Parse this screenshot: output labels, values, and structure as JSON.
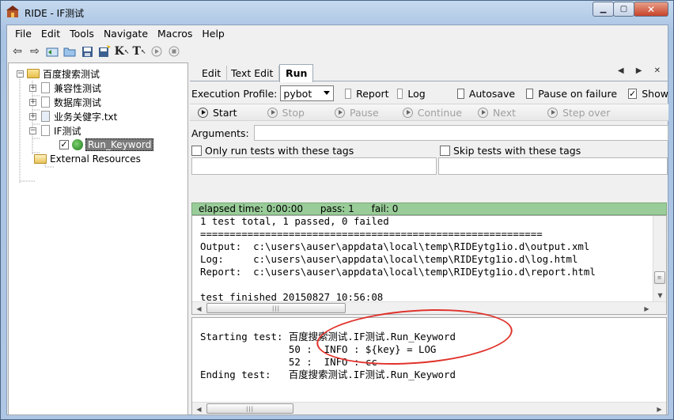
{
  "window": {
    "title": "RIDE - IF测试",
    "icons": [
      "ride-app-icon",
      "minimize-icon",
      "maximize-icon",
      "close-icon"
    ]
  },
  "menu": [
    "File",
    "Edit",
    "Tools",
    "Navigate",
    "Macros",
    "Help"
  ],
  "toolbar_icons": [
    "back-arrow-icon",
    "forward-arrow-icon",
    "open-suite-icon",
    "open-folder-icon",
    "save-icon",
    "save-all-icon",
    "search-keyword-icon",
    "search-test-icon",
    "run-icon",
    "stop-icon"
  ],
  "tree": {
    "root": "百度搜索测试",
    "children": [
      "兼容性测试",
      "数据库测试",
      "业务关健字.txt",
      "IF测试"
    ],
    "selected_test": "Run_Keyword",
    "external": "External Resources"
  },
  "tabs": [
    "Edit",
    "Text Edit",
    "Run"
  ],
  "profile": {
    "label": "Execution Profile:",
    "value": "pybot",
    "report": "Report",
    "log": "Log",
    "autosave": "Autosave",
    "pause_on_failure": "Pause on failure",
    "show": "Show"
  },
  "run_controls": {
    "start": "Start",
    "stop": "Stop",
    "pause": "Pause",
    "continue": "Continue",
    "next": "Next",
    "step_over": "Step over"
  },
  "arguments": {
    "label": "Arguments:",
    "value": ""
  },
  "tags": {
    "only_run": "Only run tests with these tags",
    "skip": "Skip tests with these tags"
  },
  "status": {
    "elapsed": "elapsed time: 0:00:00",
    "pass": "pass: 1",
    "fail": "fail: 0"
  },
  "output_lines": [
    "1 test total, 1 passed, 0 failed",
    "==========================================================",
    "Output:  c:\\users\\auser\\appdata\\local\\temp\\RIDEytg1io.d\\output.xml",
    "Log:     c:\\users\\auser\\appdata\\local\\temp\\RIDEytg1io.d\\log.html",
    "Report:  c:\\users\\auser\\appdata\\local\\temp\\RIDEytg1io.d\\report.html",
    "",
    "test finished 20150827 10:56:08"
  ],
  "log_lines": [
    "Starting test: 百度搜索测试.IF测试.Run_Keyword",
    "               50 :  INFO : ${key} = LOG",
    "               52 :  INFO : cc",
    "Ending test:   百度搜索测试.IF测试.Run_Keyword"
  ]
}
